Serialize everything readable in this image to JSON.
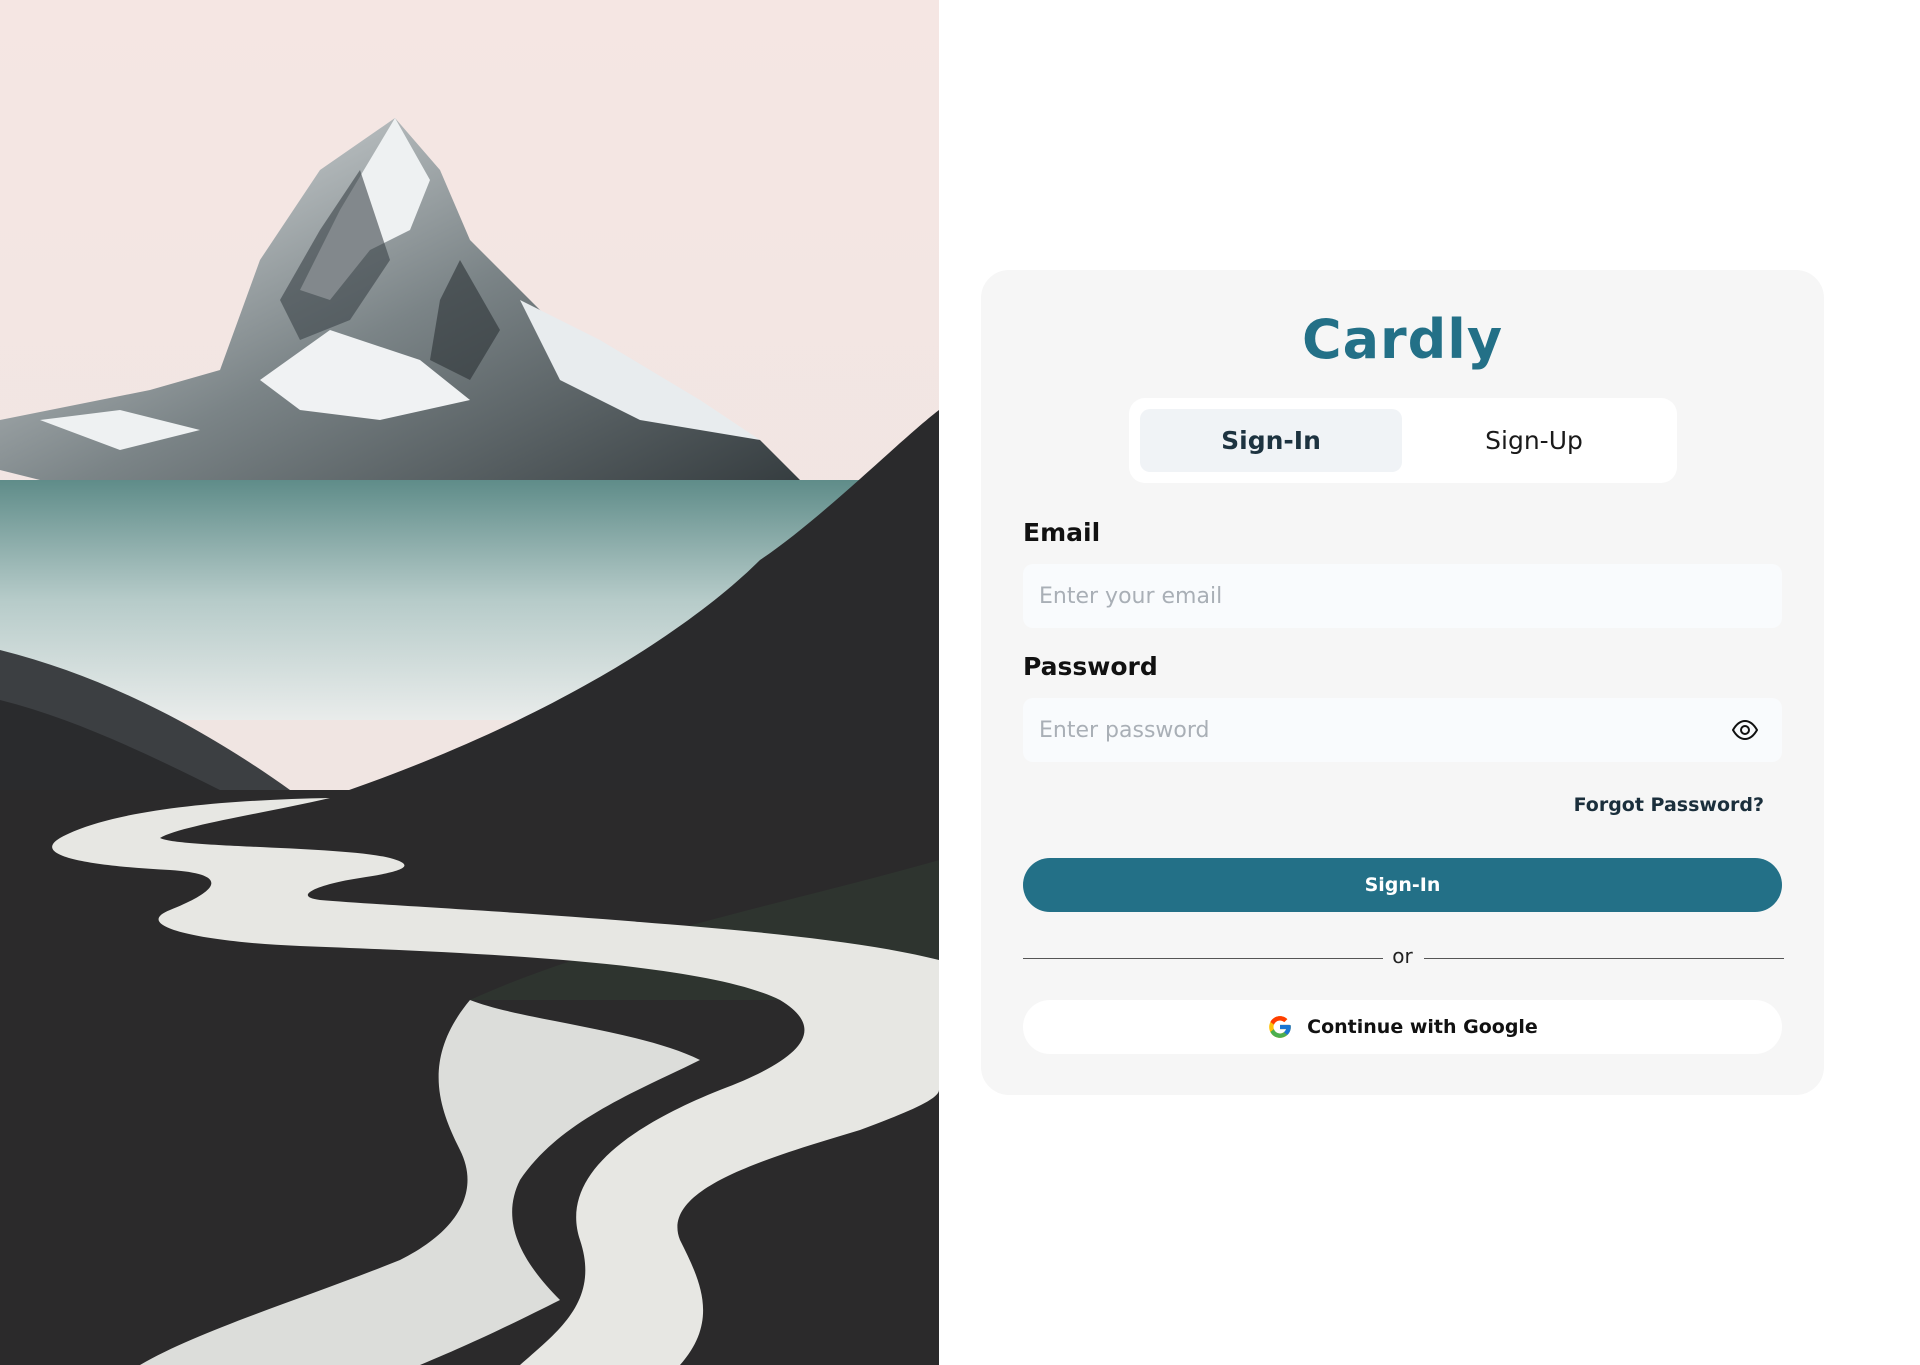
{
  "hero": {
    "image": "mountain-valley-landscape"
  },
  "brand": {
    "name": "Cardly",
    "color": "#237087"
  },
  "tabs": [
    {
      "label": "Sign-In",
      "active": true
    },
    {
      "label": "Sign-Up",
      "active": false
    }
  ],
  "form": {
    "email": {
      "label": "Email",
      "placeholder": "Enter your email",
      "value": ""
    },
    "password": {
      "label": "Password",
      "placeholder": "Enter password",
      "value": "",
      "toggle_icon": "eye-icon"
    },
    "forgot_label": "Forgot Password?",
    "submit_label": "Sign-In",
    "divider_text": "or",
    "google_label": "Continue with Google",
    "google_icon": "google-icon"
  },
  "colors": {
    "accent": "#237087",
    "card_bg": "#f6f6f6",
    "input_bg": "#f9fbfd"
  }
}
